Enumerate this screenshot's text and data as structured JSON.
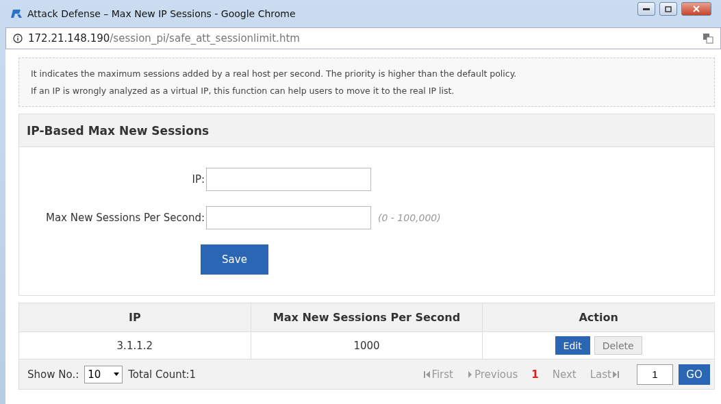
{
  "window": {
    "title": "Attack Defense – Max New IP Sessions - Google Chrome"
  },
  "address_bar": {
    "host": "172.21.148.190",
    "path": "/session_pi/safe_att_sessionlimit.htm"
  },
  "notice": [
    "It indicates the maximum sessions added by a real host per second. The priority is higher than the default policy.",
    "If an IP is wrongly analyzed as a virtual IP, this function can help users to move it to the real IP list."
  ],
  "form": {
    "title": "IP-Based Max New Sessions",
    "fields": [
      {
        "label": "IP:"
      },
      {
        "label": "Max New Sessions Per Second:",
        "hint": "(0 - 100,000)"
      }
    ],
    "save_button": "Save"
  },
  "table": {
    "columns": [
      "IP",
      "Max New Sessions Per Second",
      "Action"
    ],
    "rows": [
      {
        "ip": "3.1.1.2",
        "max": "1000",
        "actions": [
          {
            "label": "Edit",
            "kind": "primary"
          },
          {
            "label": "Delete",
            "kind": "secondary"
          }
        ]
      }
    ]
  },
  "footer": {
    "show_label": "Show No.:",
    "page_size": "10",
    "total": "Total Count:1",
    "pager": [
      {
        "label": "First",
        "kind": "first",
        "disabled": true
      },
      {
        "label": "Previous",
        "kind": "prev",
        "disabled": true
      },
      {
        "label": "1",
        "kind": "page",
        "selected": true
      },
      {
        "label": "Next",
        "kind": "next",
        "disabled": true
      },
      {
        "label": "Last",
        "kind": "last",
        "disabled": true
      }
    ],
    "page_input": "1",
    "go": "GO"
  }
}
